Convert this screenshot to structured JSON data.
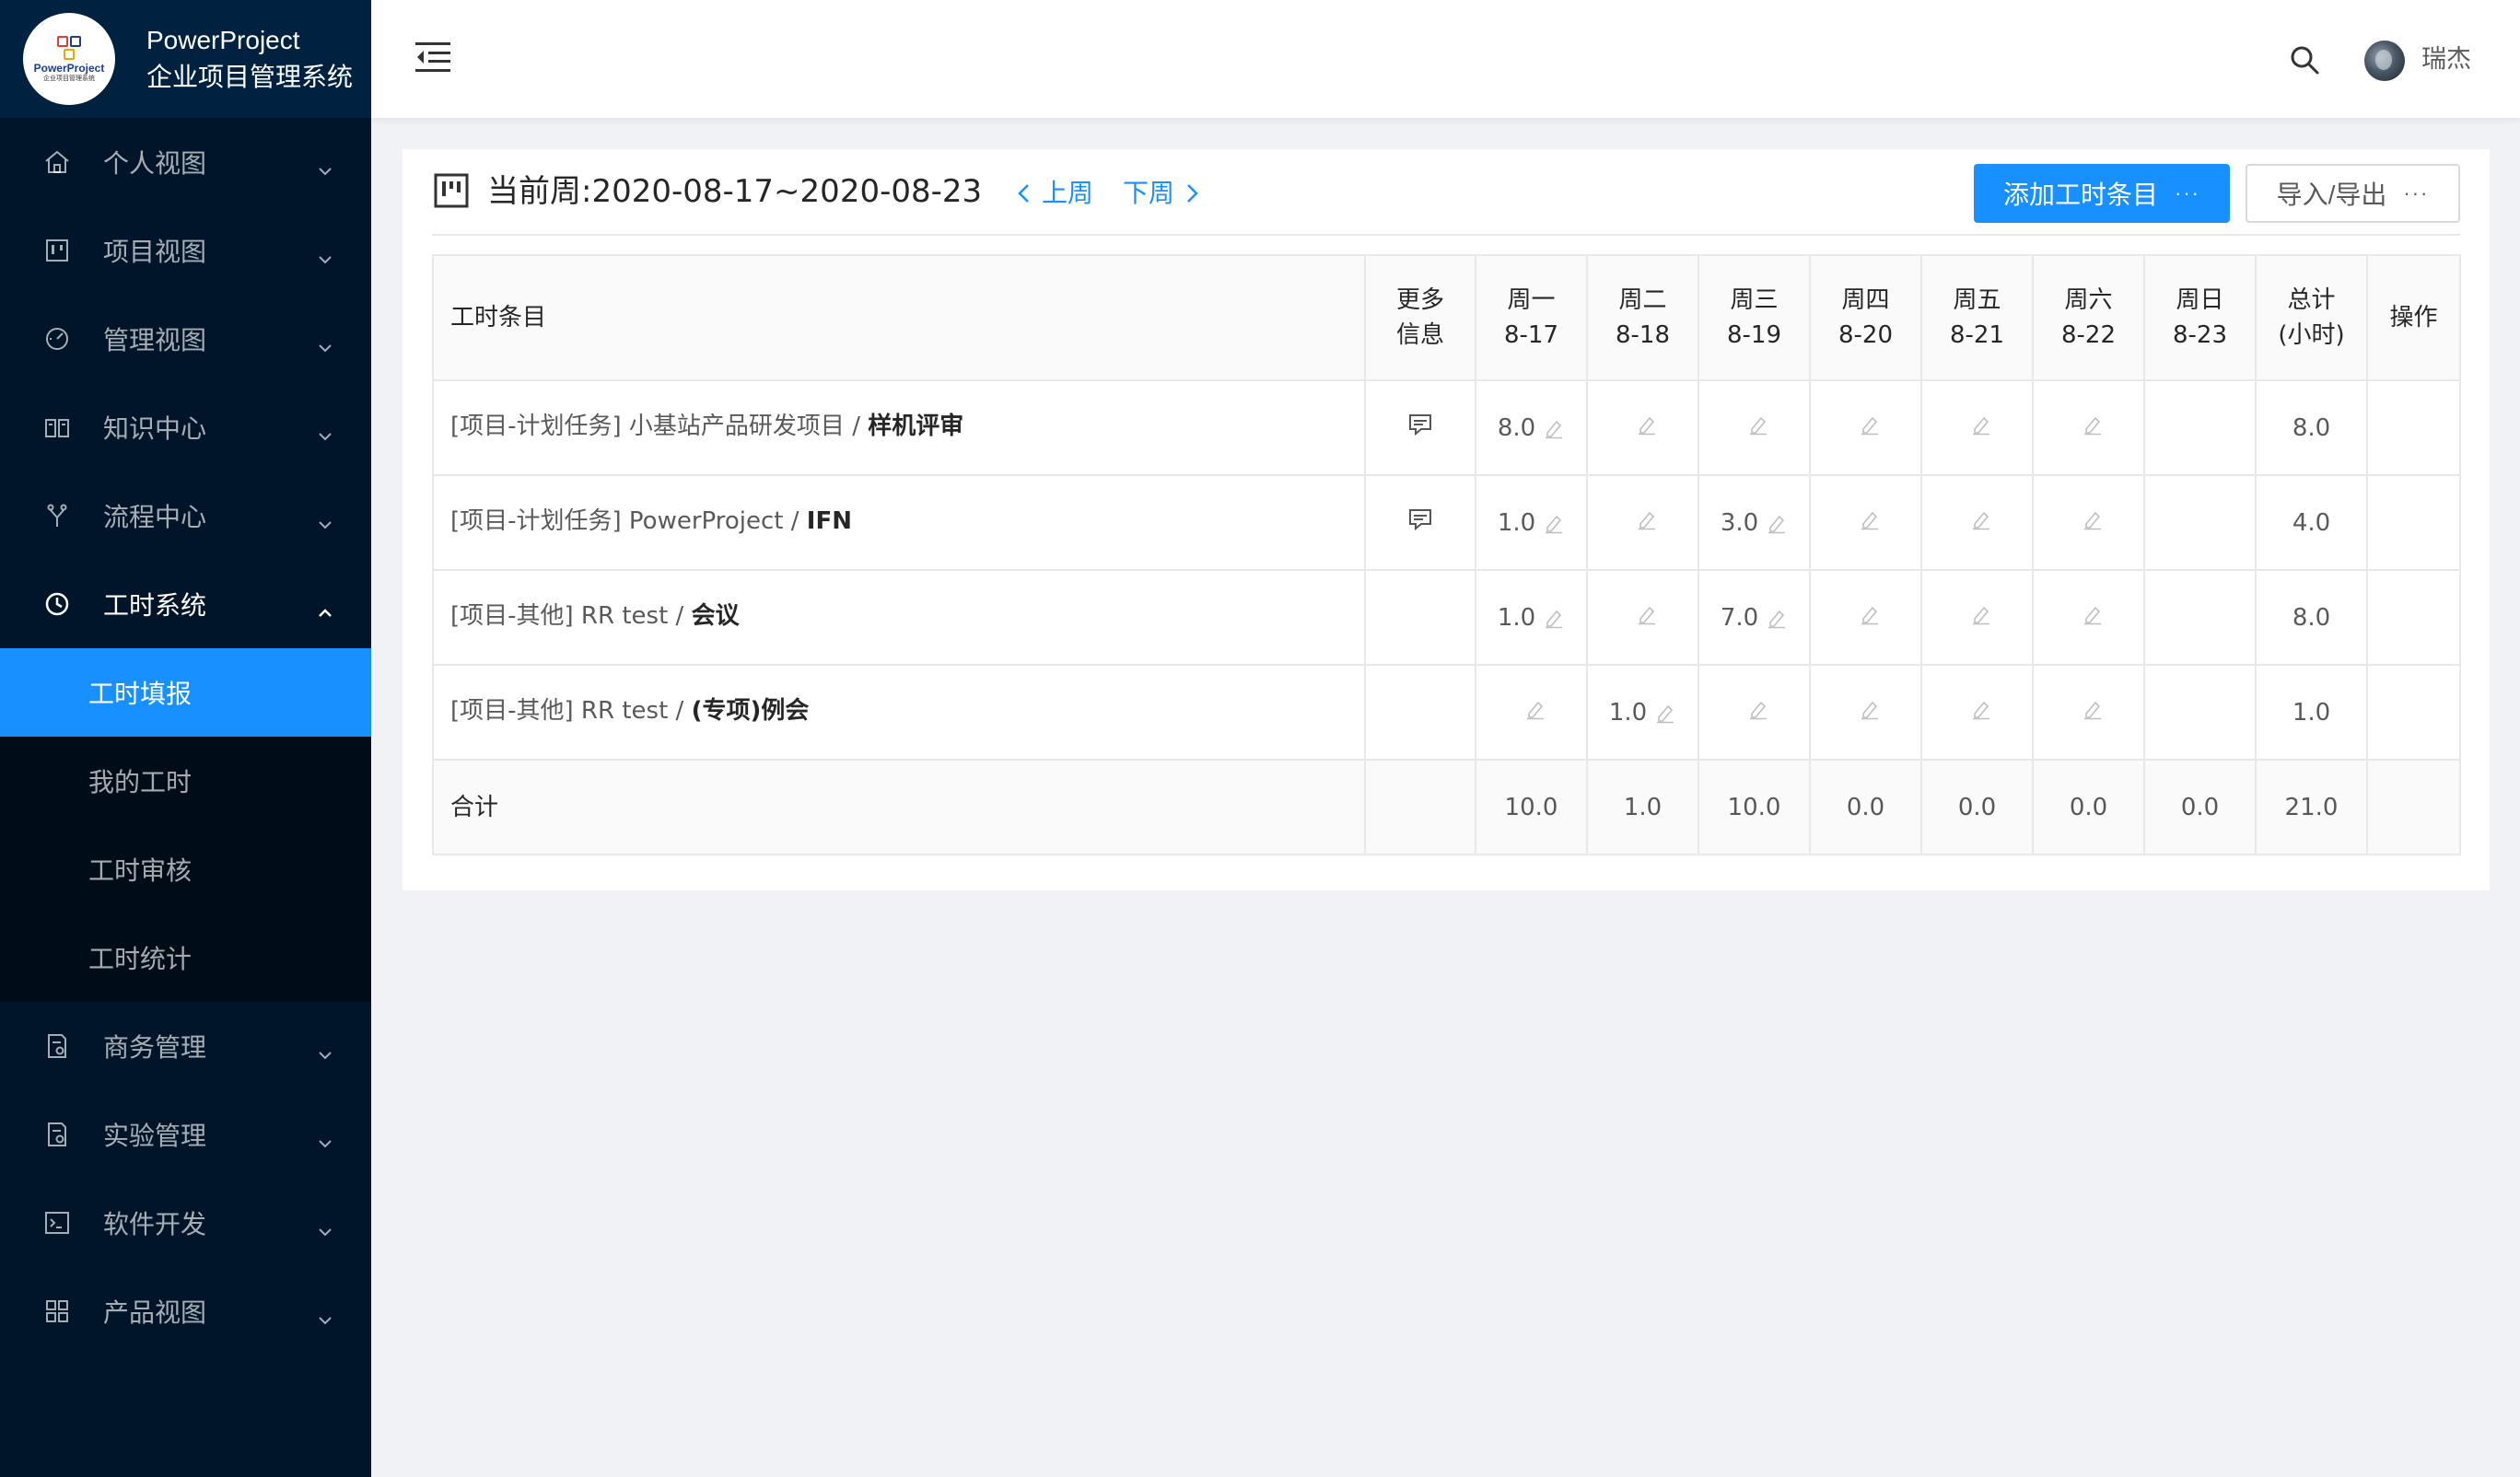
{
  "brand": {
    "logo_title": "PowerProject",
    "logo_subtitle": "企业项目管理系统",
    "app_title": "PowerProject",
    "app_subtitle": "企业项目管理系统"
  },
  "sidebar": {
    "items": [
      {
        "label": "个人视图",
        "icon": "home-icon"
      },
      {
        "label": "项目视图",
        "icon": "board-icon"
      },
      {
        "label": "管理视图",
        "icon": "dashboard-icon"
      },
      {
        "label": "知识中心",
        "icon": "book-icon"
      },
      {
        "label": "流程中心",
        "icon": "branch-icon"
      },
      {
        "label": "工时系统",
        "icon": "clock-icon",
        "open": true
      },
      {
        "label": "商务管理",
        "icon": "document-icon"
      },
      {
        "label": "实验管理",
        "icon": "document-icon"
      },
      {
        "label": "软件开发",
        "icon": "code-icon"
      },
      {
        "label": "产品视图",
        "icon": "grid-icon"
      }
    ],
    "submenu": [
      {
        "label": "工时填报",
        "active": true
      },
      {
        "label": "我的工时"
      },
      {
        "label": "工时审核"
      },
      {
        "label": "工时统计"
      }
    ]
  },
  "header": {
    "username": "瑞杰"
  },
  "week": {
    "label": "当前周:",
    "range": "2020-08-17~2020-08-23",
    "prev_label": "上周",
    "next_label": "下周",
    "add_button": "添加工时条目",
    "io_button": "导入/导出"
  },
  "table": {
    "headers": {
      "entry": "工时条目",
      "info": [
        "更多",
        "信息"
      ],
      "days": [
        [
          "周一",
          "8-17"
        ],
        [
          "周二",
          "8-18"
        ],
        [
          "周三",
          "8-19"
        ],
        [
          "周四",
          "8-20"
        ],
        [
          "周五",
          "8-21"
        ],
        [
          "周六",
          "8-22"
        ],
        [
          "周日",
          "8-23"
        ]
      ],
      "total": [
        "总计",
        "(小时)"
      ],
      "op": "操作"
    },
    "rows": [
      {
        "prefix": "[项目-计划任务] 小基站产品研发项目 / ",
        "name": "样机评审",
        "has_info": true,
        "days": [
          "8.0",
          "",
          "",
          "",
          "",
          "",
          ""
        ],
        "total": "8.0"
      },
      {
        "prefix": "[项目-计划任务] PowerProject / ",
        "name": "IFN",
        "has_info": true,
        "days": [
          "1.0",
          "",
          "3.0",
          "",
          "",
          "",
          ""
        ],
        "total": "4.0"
      },
      {
        "prefix": "[项目-其他] RR test / ",
        "name": "会议",
        "has_info": false,
        "days": [
          "1.0",
          "",
          "7.0",
          "",
          "",
          "",
          ""
        ],
        "total": "8.0"
      },
      {
        "prefix": "[项目-其他] RR test / ",
        "name": "(专项)例会",
        "has_info": false,
        "days": [
          "",
          "1.0",
          "",
          "",
          "",
          "",
          ""
        ],
        "total": "1.0"
      }
    ],
    "totals": {
      "label": "合计",
      "days": [
        "10.0",
        "1.0",
        "10.0",
        "0.0",
        "0.0",
        "0.0",
        "0.0"
      ],
      "total": "21.0"
    }
  }
}
